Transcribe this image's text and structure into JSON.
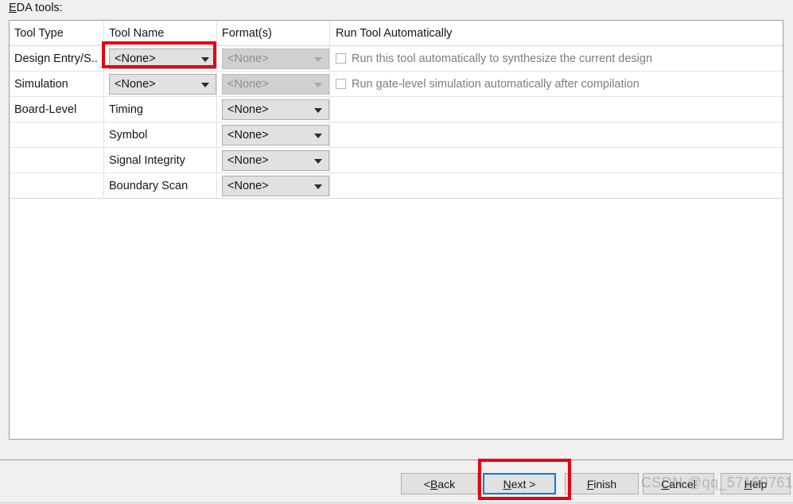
{
  "dialog": {
    "eda_label_mnemonic": "E",
    "eda_label_rest": "DA tools:"
  },
  "table": {
    "columns": [
      "Tool Type",
      "Tool Name",
      "Format(s)",
      "Run Tool Automatically"
    ],
    "rows": [
      {
        "tool_type": "Design Entry/S..",
        "tool_name": "<None>",
        "format": "<None>",
        "format_disabled": true,
        "run_label": "Run this tool automatically to synthesize the current design",
        "run_checked": false,
        "has_run": true,
        "highlighted": true
      },
      {
        "tool_type": "Simulation",
        "tool_name": "<None>",
        "format": "<None>",
        "format_disabled": true,
        "run_label": "Run gate-level simulation automatically after compilation",
        "run_checked": false,
        "has_run": true,
        "highlighted": false
      },
      {
        "tool_type": "Board-Level",
        "tool_name": "Timing",
        "format": "<None>",
        "format_disabled": false,
        "run_label": "",
        "run_checked": false,
        "has_run": false,
        "highlighted": false
      },
      {
        "tool_type": "",
        "tool_name": "Symbol",
        "format": "<None>",
        "format_disabled": false,
        "run_label": "",
        "run_checked": false,
        "has_run": false,
        "highlighted": false
      },
      {
        "tool_type": "",
        "tool_name": "Signal Integrity",
        "format": "<None>",
        "format_disabled": false,
        "run_label": "",
        "run_checked": false,
        "has_run": false,
        "highlighted": false
      },
      {
        "tool_type": "",
        "tool_name": "Boundary Scan",
        "format": "<None>",
        "format_disabled": false,
        "run_label": "",
        "run_checked": false,
        "has_run": false,
        "highlighted": false
      }
    ]
  },
  "buttons": {
    "back": {
      "pre": "< ",
      "mnemonic": "B",
      "post": "ack"
    },
    "next": {
      "pre": "",
      "mnemonic": "N",
      "post": "ext >"
    },
    "finish": {
      "pre": "",
      "mnemonic": "F",
      "post": "inish"
    },
    "cancel": {
      "pre": "",
      "mnemonic": "C",
      "post": "ancel"
    },
    "help": {
      "pre": "",
      "mnemonic": "H",
      "post": "elp"
    }
  },
  "watermark": {
    "text": "CSDN @qq_57160761"
  },
  "colors": {
    "highlight_red": "#e60012",
    "focus_blue": "#0a7bd4",
    "panel_bg": "#f0f0f0",
    "table_bg": "#ffffff",
    "combo_bg": "#e1e1e1",
    "combo_disabled_bg": "#d0d0d0"
  }
}
